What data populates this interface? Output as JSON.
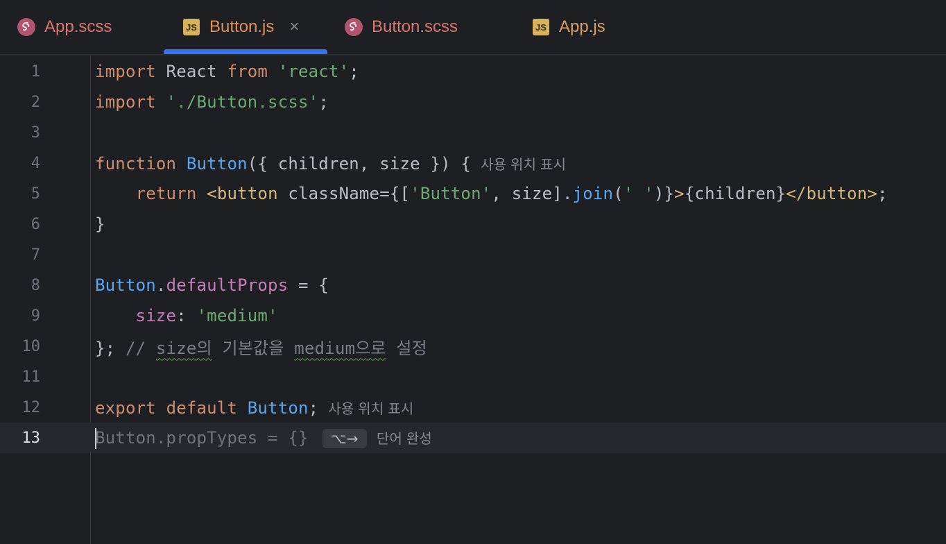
{
  "tabs": [
    {
      "label": "App.scss",
      "type": "scss",
      "active": false
    },
    {
      "label": "Button.js",
      "type": "js",
      "active": true
    },
    {
      "label": "Button.scss",
      "type": "scss",
      "active": false
    },
    {
      "label": "App.js",
      "type": "js",
      "active": false
    }
  ],
  "icons": {
    "js_text": "JS",
    "close": "×"
  },
  "editor": {
    "current_line": 13,
    "lines": [
      {
        "n": "1"
      },
      {
        "n": "2"
      },
      {
        "n": "3"
      },
      {
        "n": "4"
      },
      {
        "n": "5"
      },
      {
        "n": "6"
      },
      {
        "n": "7"
      },
      {
        "n": "8"
      },
      {
        "n": "9"
      },
      {
        "n": "10"
      },
      {
        "n": "11"
      },
      {
        "n": "12"
      },
      {
        "n": "13"
      }
    ],
    "hints": {
      "usages": "사용 위치 표시",
      "complete_word": "단어 완성",
      "shortcut": "⌥→"
    },
    "tokens": {
      "l1": [
        "import",
        " React ",
        "from",
        " ",
        "'react'",
        ";"
      ],
      "l2": [
        "import",
        " ",
        "'./Button.scss'",
        ";"
      ],
      "l4": [
        "function",
        " ",
        "Button",
        "({ children, size }) {"
      ],
      "l5": [
        "    ",
        "return",
        " ",
        "<button",
        " className",
        "=",
        "{[",
        "'Button'",
        ", size].",
        "join",
        "(",
        "' '",
        ")}",
        ">",
        "{children}",
        "</button>",
        ";"
      ],
      "l6": [
        "}"
      ],
      "l8": [
        "Button",
        ".",
        "defaultProps",
        " = {"
      ],
      "l9": [
        "    ",
        "size",
        ": ",
        "'medium'"
      ],
      "l10": [
        "}; ",
        "// ",
        "size의",
        " 기본값을 ",
        "medium으로",
        " 설정"
      ],
      "l12": [
        "export",
        " ",
        "default",
        " ",
        "Button",
        ";"
      ],
      "l13": [
        "Button.propTypes = {}"
      ]
    }
  },
  "colors": {
    "background": "#1e1f22",
    "accent": "#3574f0",
    "keyword": "#cf8e6d",
    "string": "#6aab73",
    "function": "#56a8f5",
    "property": "#c77dbb"
  }
}
